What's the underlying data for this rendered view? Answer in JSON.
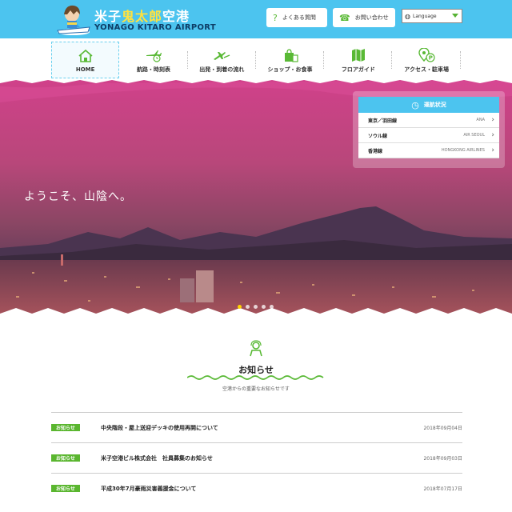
{
  "header": {
    "logo_jp_part1": "米子",
    "logo_jp_part2": "鬼太郎",
    "logo_jp_part3": "空港",
    "logo_en": "YONAGO KITARO AIRPORT",
    "faq_label": "よくある質問",
    "contact_label": "お問い合わせ",
    "language_label": "Language",
    "colors": {
      "topbar": "#4cc4ef",
      "accent_green": "#59b935",
      "logo_yellow": "#ffe23f"
    }
  },
  "nav": {
    "items": [
      {
        "label": "HOME",
        "icon": "house-icon",
        "active": true
      },
      {
        "label": "航路・時刻表",
        "icon": "plane-clock-icon"
      },
      {
        "label": "出発・到着の流れ",
        "icon": "departure-arrival-icon"
      },
      {
        "label": "ショップ・お食事",
        "icon": "shopping-bag-icon"
      },
      {
        "label": "フロアガイド",
        "icon": "map-icon"
      },
      {
        "label": "アクセス・駐車場",
        "icon": "location-parking-icon"
      }
    ]
  },
  "hero": {
    "welcome": "ようこそ、山陰へ。",
    "slides_total": 5,
    "active_slide": 1
  },
  "flight_panel": {
    "title": "運航状況",
    "routes": [
      {
        "route": "東京／羽田線",
        "airline": "ANA"
      },
      {
        "route": "ソウル線",
        "airline": "AIR SEOUL"
      },
      {
        "route": "香港線",
        "airline": "HONGKONG AIRLINES"
      }
    ]
  },
  "news": {
    "title": "お知らせ",
    "subtitle": "空港からの重要なお知らせです",
    "items": [
      {
        "tag": "お知らせ",
        "title": "中央階段・屋上送迎デッキの使用再開について",
        "date": "2018年09月04日"
      },
      {
        "tag": "お知らせ",
        "title": "米子空港ビル株式会社　社員募集のお知らせ",
        "date": "2018年09月03日"
      },
      {
        "tag": "お知らせ",
        "title": "平成30年7月豪雨災害義援金について",
        "date": "2018年07月17日"
      }
    ]
  }
}
